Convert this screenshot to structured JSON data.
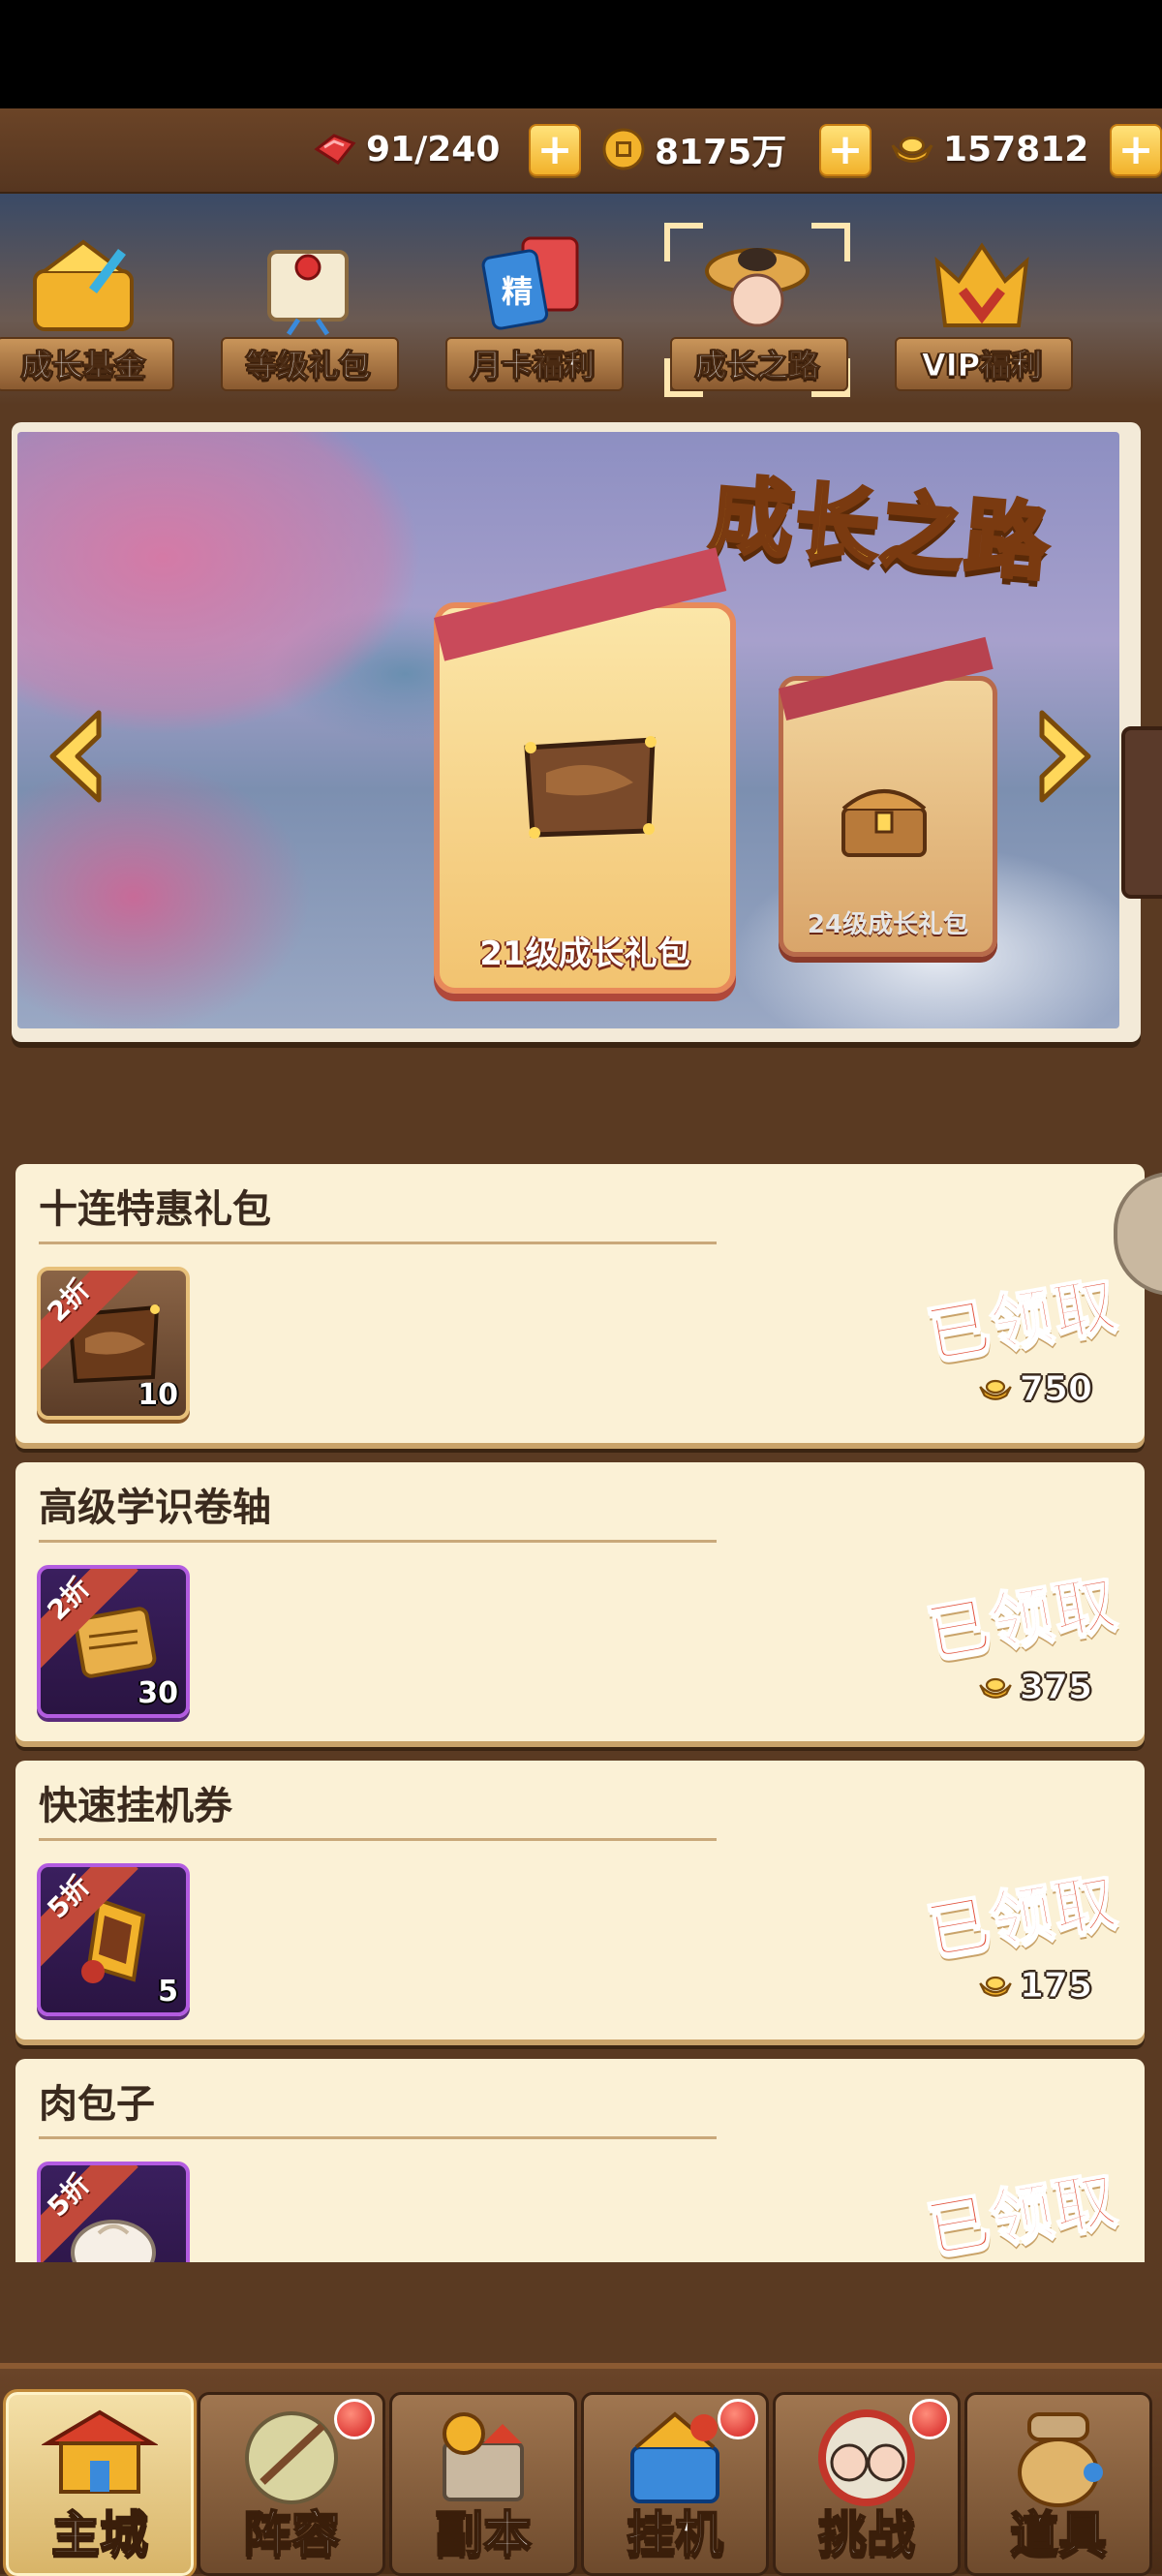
{
  "currency": {
    "stamina": "91/240",
    "coins": "8175万",
    "ingots": "157812",
    "plus": "+"
  },
  "tabs": [
    {
      "label": "成长基金"
    },
    {
      "label": "等级礼包"
    },
    {
      "label": "月卡福利",
      "card_text": "精"
    },
    {
      "label": "成长之路",
      "selected": true
    },
    {
      "label": "VIP福利"
    }
  ],
  "banner": {
    "title": "成长之路",
    "main_card": "21级成长礼包",
    "side_card": "24级成长礼包"
  },
  "packs": [
    {
      "name": "十连特惠礼包",
      "discount": "2折",
      "count": "10",
      "status": "已领取",
      "price": "750",
      "frame": "brown"
    },
    {
      "name": "高级学识卷轴",
      "discount": "2折",
      "count": "30",
      "status": "已领取",
      "price": "375",
      "frame": "purple"
    },
    {
      "name": "快速挂机券",
      "discount": "5折",
      "count": "5",
      "status": "已领取",
      "price": "175",
      "frame": "purple"
    },
    {
      "name": "肉包子",
      "discount": "5折",
      "count": "",
      "status": "已领取",
      "price": "",
      "frame": "purple"
    }
  ],
  "nav": [
    {
      "label": "主城",
      "active": true
    },
    {
      "label": "阵容",
      "badge": true
    },
    {
      "label": "副本"
    },
    {
      "label": "挂机",
      "badge": true
    },
    {
      "label": "挑战",
      "badge": true
    },
    {
      "label": "道具"
    }
  ],
  "colors": {
    "wood": "#5a3a22",
    "parchment": "#fbf1d6",
    "claimed_red": "#e0503a",
    "gold": "#ffcf3a"
  }
}
